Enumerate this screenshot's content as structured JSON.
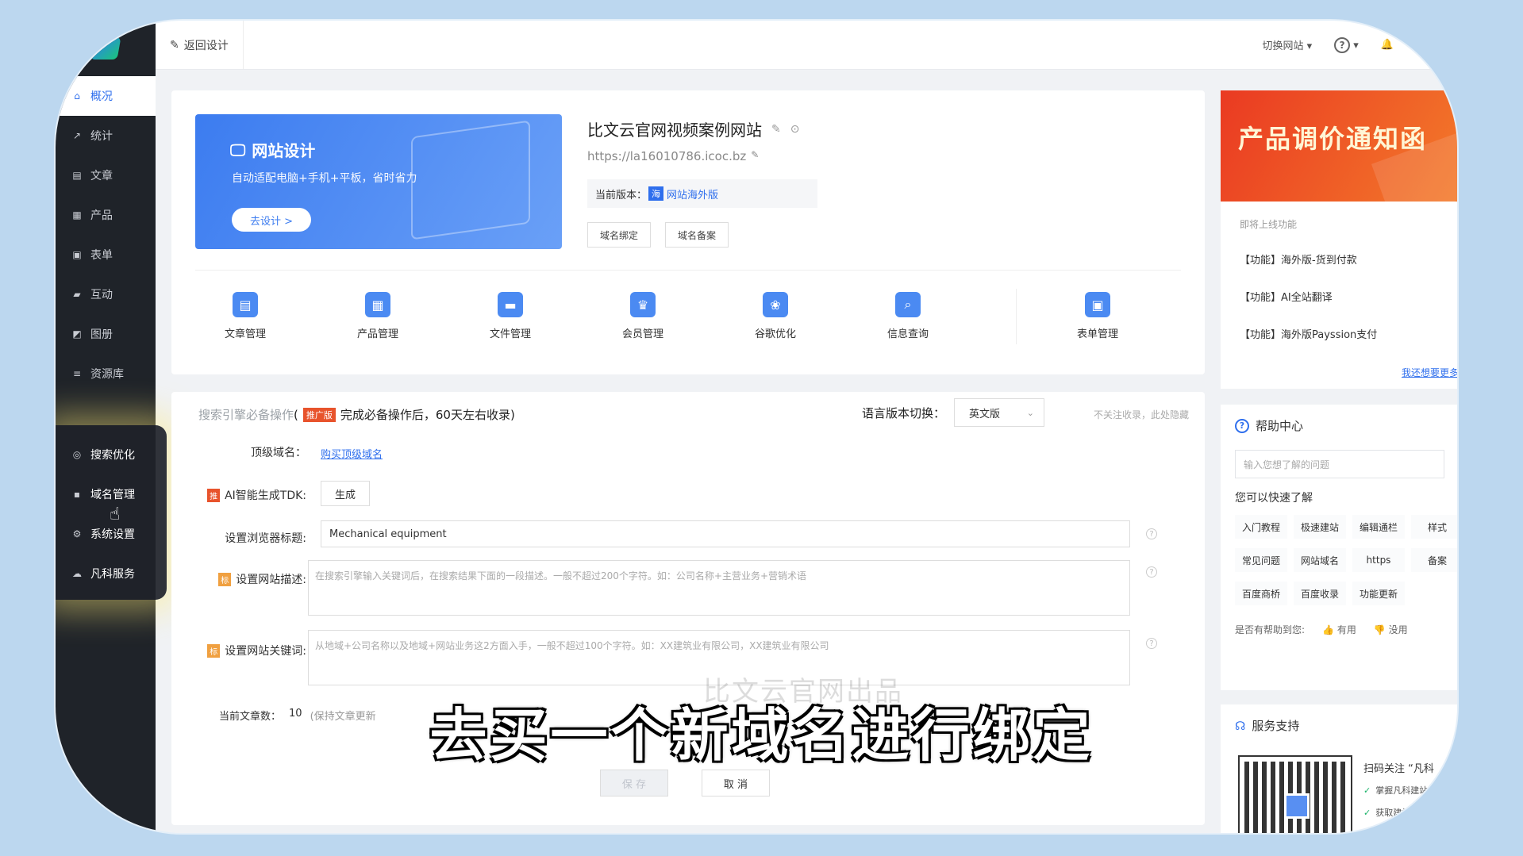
{
  "sidebar": {
    "items": [
      {
        "label": "概况",
        "icon": "home-icon"
      },
      {
        "label": "统计",
        "icon": "chart-icon"
      },
      {
        "label": "文章",
        "icon": "article-icon"
      },
      {
        "label": "产品",
        "icon": "product-icon"
      },
      {
        "label": "表单",
        "icon": "form-icon"
      },
      {
        "label": "互动",
        "icon": "chat-icon"
      },
      {
        "label": "图册",
        "icon": "gallery-icon"
      },
      {
        "label": "资源库",
        "icon": "database-icon"
      }
    ],
    "popout_items": [
      {
        "label": "搜索优化",
        "icon": "search-optimize-icon"
      },
      {
        "label": "域名管理",
        "icon": "domain-icon"
      },
      {
        "label": "系统设置",
        "icon": "gear-icon"
      },
      {
        "label": "凡科服务",
        "icon": "service-icon"
      }
    ]
  },
  "topbar": {
    "back_label": "返回设计",
    "switch_site": "切换网站"
  },
  "banner": {
    "title": "网站设计",
    "subtitle": "自动适配电脑+手机+平板，省时省力",
    "button": "去设计 >"
  },
  "site": {
    "name": "比文云官网视频案例网站",
    "url": "https://la16010786.icoc.bz",
    "version_label": "当前版本：",
    "version_tag": "海",
    "version_value": "网站海外版",
    "btn_domain_bind": "域名绑定",
    "btn_domain_record": "域名备案"
  },
  "quick_links": [
    "文章管理",
    "产品管理",
    "文件管理",
    "会员管理",
    "谷歌优化",
    "信息查询",
    "表单管理"
  ],
  "seo": {
    "head_faded": "搜索引擎必备操作",
    "head_tag": "推广版",
    "head_text": "完成必备操作后，60天左右收录)",
    "lang_label": "语言版本切换：",
    "lang_value": "英文版",
    "hide_link": "不关注收录，此处隐藏",
    "top_domain_label": "顶级域名：",
    "top_domain_link": "购买顶级域名",
    "ai_badge": "推",
    "ai_label": "AI智能生成TDK:",
    "ai_button": "生成",
    "title_label": "设置浏览器标题:",
    "title_value": "Mechanical equipment",
    "desc_badge": "标",
    "desc_label": "设置网站描述:",
    "desc_placeholder": "在搜索引擎输入关键词后，在搜索结果下面的一段描述。一般不超过200个字符。如：公司名称+主营业务+营销术语",
    "kw_badge": "标",
    "kw_label": "设置网站关键词:",
    "kw_placeholder": "从地域+公司名称以及地域+网站业务这2方面入手，一般不超过100个字符。如：XX建筑业有限公司，XX建筑业有限公司",
    "count_label": "当前文章数：",
    "count_value": "10",
    "count_note": "(保持文章更新",
    "save": "保 存",
    "cancel": "取 消"
  },
  "promo": {
    "title": "产品调价通知函"
  },
  "upcoming": {
    "title": "即将上线功能",
    "items": [
      "【功能】海外版-货到付款",
      "【功能】AI全站翻译",
      "【功能】海外版Payssion支付"
    ],
    "more": "我还想要更多"
  },
  "help": {
    "title": "帮助中心",
    "search_placeholder": "输入您想了解的问题",
    "sub": "您可以快速了解",
    "chips": [
      "入门教程",
      "极速建站",
      "编辑通栏",
      "样式",
      "常见问题",
      "网站域名",
      "https",
      "备案",
      "百度商桥",
      "百度收录",
      "功能更新"
    ],
    "feedback_q": "是否有帮助到您:",
    "useful": "有用",
    "useless": "没用"
  },
  "support": {
    "title": "服务支持",
    "scan_text": "扫码关注 “凡科",
    "checks": [
      "掌握凡科建站",
      "获取建站"
    ]
  },
  "watermark": "比文云官网出品",
  "caption": "去买一个新域名进行绑定"
}
